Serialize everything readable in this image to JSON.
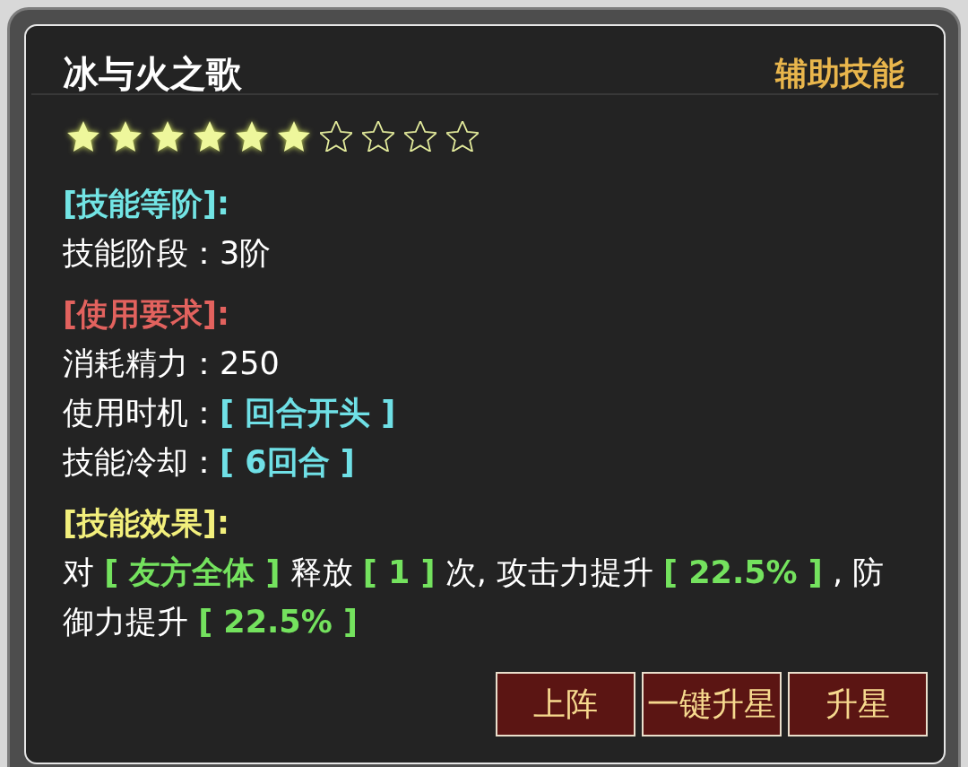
{
  "dialog": {
    "title": "冰与火之歌",
    "category": "辅助技能",
    "stars": 6
  },
  "sections": [
    {
      "heading": "[技能等阶]:",
      "color": "#72e4e4",
      "kind": "fields",
      "fields": [
        {
          "label": "技能阶段：",
          "value": "3阶",
          "kind": "plain"
        }
      ]
    },
    {
      "heading": "[使用要求]:",
      "color": "#e2625e",
      "kind": "fields",
      "fields": [
        {
          "label": "消耗精力：",
          "value": "250",
          "kind": "plain"
        },
        {
          "label": "使用时机：",
          "value": "[ 回合开头 ]",
          "kind": "bracket"
        },
        {
          "label": "技能冷却：",
          "value": "[ 6回合 ]",
          "kind": "bracket"
        }
      ]
    },
    {
      "heading": "[技能效果]:",
      "color": "#f2ef7c",
      "kind": "effect",
      "segments": [
        {
          "text": "对 ",
          "kind": "plain"
        },
        {
          "text": "[ 友方全体 ]",
          "kind": "highlight"
        },
        {
          "text": " 释放 ",
          "kind": "plain"
        },
        {
          "text": "[ 1 ]",
          "kind": "highlight"
        },
        {
          "text": " 次, 攻击力提升 ",
          "kind": "plain"
        },
        {
          "text": "[ 22.5% ]",
          "kind": "highlight"
        },
        {
          "text": " , 防御力提升 ",
          "kind": "plain"
        },
        {
          "text": "[ 22.5% ]",
          "kind": "highlight"
        }
      ]
    }
  ],
  "buttons": [
    "上阵",
    "一键升星",
    "升星"
  ]
}
